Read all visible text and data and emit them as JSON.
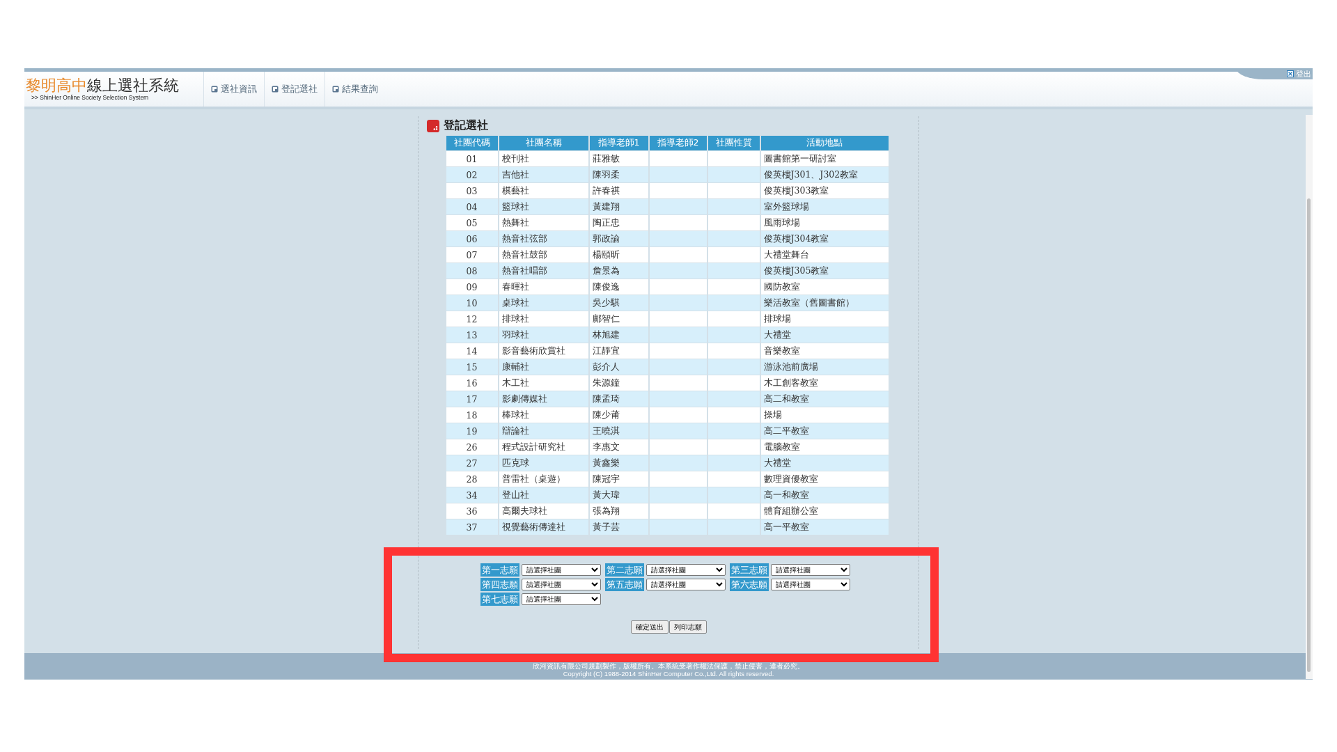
{
  "header": {
    "school": "黎明高中",
    "title": "線上選社系統",
    "subtitle": ">> ShinHer Online Society Selection System",
    "nav": [
      {
        "label": "選社資訊"
      },
      {
        "label": "登記選社"
      },
      {
        "label": "結果查詢"
      }
    ],
    "logout": "登出"
  },
  "section_title": "登記選社",
  "table": {
    "columns": [
      "社團代碼",
      "社團名稱",
      "指導老師1",
      "指導老師2",
      "社團性質",
      "活動地點"
    ],
    "rows": [
      [
        "01",
        "校刊社",
        "莊雅敏",
        "",
        "",
        "圖書館第一研討室"
      ],
      [
        "02",
        "吉他社",
        "陳羽柔",
        "",
        "",
        "俊英樓J301、J302教室"
      ],
      [
        "03",
        "棋藝社",
        "許春祺",
        "",
        "",
        "俊英樓J303教室"
      ],
      [
        "04",
        "籃球社",
        "黃建翔",
        "",
        "",
        "室外籃球場"
      ],
      [
        "05",
        "熱舞社",
        "陶正忠",
        "",
        "",
        "風雨球場"
      ],
      [
        "06",
        "熱音社弦部",
        "郭政諭",
        "",
        "",
        "俊英樓J304教室"
      ],
      [
        "07",
        "熱音社鼓部",
        "楊頤昕",
        "",
        "",
        "大禮堂舞台"
      ],
      [
        "08",
        "熱音社唱部",
        "詹景為",
        "",
        "",
        "俊英樓J305教室"
      ],
      [
        "09",
        "春暉社",
        "陳俊逸",
        "",
        "",
        "國防教室"
      ],
      [
        "10",
        "桌球社",
        "吳少騏",
        "",
        "",
        "樂活教室（舊圖書館）"
      ],
      [
        "12",
        "排球社",
        "鄺智仁",
        "",
        "",
        "排球場"
      ],
      [
        "13",
        "羽球社",
        "林旭建",
        "",
        "",
        "大禮堂"
      ],
      [
        "14",
        "影音藝術欣賞社",
        "江靜宜",
        "",
        "",
        "音樂教室"
      ],
      [
        "15",
        "康輔社",
        "彭介人",
        "",
        "",
        "游泳池前廣場"
      ],
      [
        "16",
        "木工社",
        "朱源鐘",
        "",
        "",
        "木工創客教室"
      ],
      [
        "17",
        "影劇傳媒社",
        "陳孟琦",
        "",
        "",
        "高二和教室"
      ],
      [
        "18",
        "棒球社",
        "陳少莆",
        "",
        "",
        "操場"
      ],
      [
        "19",
        "辯論社",
        "王曉淇",
        "",
        "",
        "高二平教室"
      ],
      [
        "26",
        "程式設計研究社",
        "李惠文",
        "",
        "",
        "電腦教室"
      ],
      [
        "27",
        "匹克球",
        "黃鑫樂",
        "",
        "",
        "大禮堂"
      ],
      [
        "28",
        "普雷社（桌遊）",
        "陳冠宇",
        "",
        "",
        "數理資優教室"
      ],
      [
        "34",
        "登山社",
        "黃大瑋",
        "",
        "",
        "高一和教室"
      ],
      [
        "36",
        "高爾夫球社",
        "張為翔",
        "",
        "",
        "體育組辦公室"
      ],
      [
        "37",
        "視覺藝術傳達社",
        "黃子芸",
        "",
        "",
        "高一平教室"
      ]
    ]
  },
  "preferences": [
    {
      "label": "第一志願",
      "value": "請選擇社團"
    },
    {
      "label": "第二志願",
      "value": "請選擇社團"
    },
    {
      "label": "第三志願",
      "value": "請選擇社團"
    },
    {
      "label": "第四志願",
      "value": "請選擇社團"
    },
    {
      "label": "第五志願",
      "value": "請選擇社團"
    },
    {
      "label": "第六志願",
      "value": "請選擇社團"
    },
    {
      "label": "第七志願",
      "value": "請選擇社團"
    }
  ],
  "buttons": [
    "確定送出",
    "列印志願"
  ],
  "footer": [
    "欣河資訊有限公司規劃製作，版權所有。本系統受著作權法保護，禁止侵害，違者必究。",
    "Copyright (C) 1988-2014 ShinHer Computer Co.,Ltd. All rights reserved."
  ]
}
